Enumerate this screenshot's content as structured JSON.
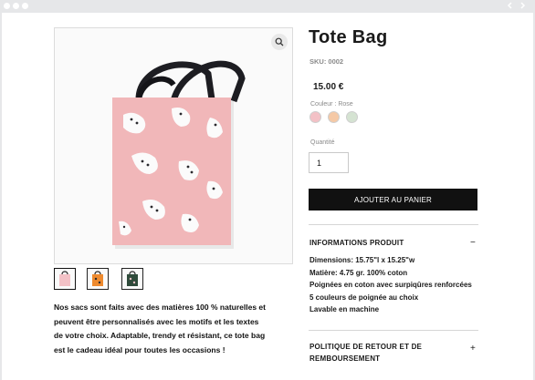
{
  "product": {
    "title": "Tote Bag",
    "sku": "SKU: 0002",
    "price": "15.00 €",
    "color_label": "Couleur : Rose",
    "swatches": [
      "#f3c1c6",
      "#f5c9a6",
      "#d5e3d2"
    ],
    "quantity_label": "Quantité",
    "quantity_value": "1",
    "cart_button": "AJOUTER AU PANIER"
  },
  "description": "Nos sacs sont faits avec des matières 100 % naturelles et peuvent être personnalisés avec les motifs et les textes de votre choix. Adaptable, trendy et résistant, ce tote bag est le cadeau idéal pour toutes les occasions !",
  "sections": {
    "info_title": "INFORMATIONS PRODUIT",
    "info_toggle": "−",
    "info_lines": [
      "Dimensions: 15.75\"l x 15.25\"w",
      "Matière: 4.75 gr. 100% coton",
      "Poignées en coton avec surpiqûres renforcées",
      "5 couleurs de poignée au choix",
      "Lavable en machine"
    ],
    "return_title": "POLITIQUE DE RETOUR ET DE REMBOURSEMENT",
    "return_toggle": "+"
  },
  "thumbnails": [
    {
      "name": "pink",
      "color": "#f3c1c6"
    },
    {
      "name": "orange",
      "color": "#ee8a2e"
    },
    {
      "name": "green",
      "color": "#2f4b3b"
    }
  ]
}
